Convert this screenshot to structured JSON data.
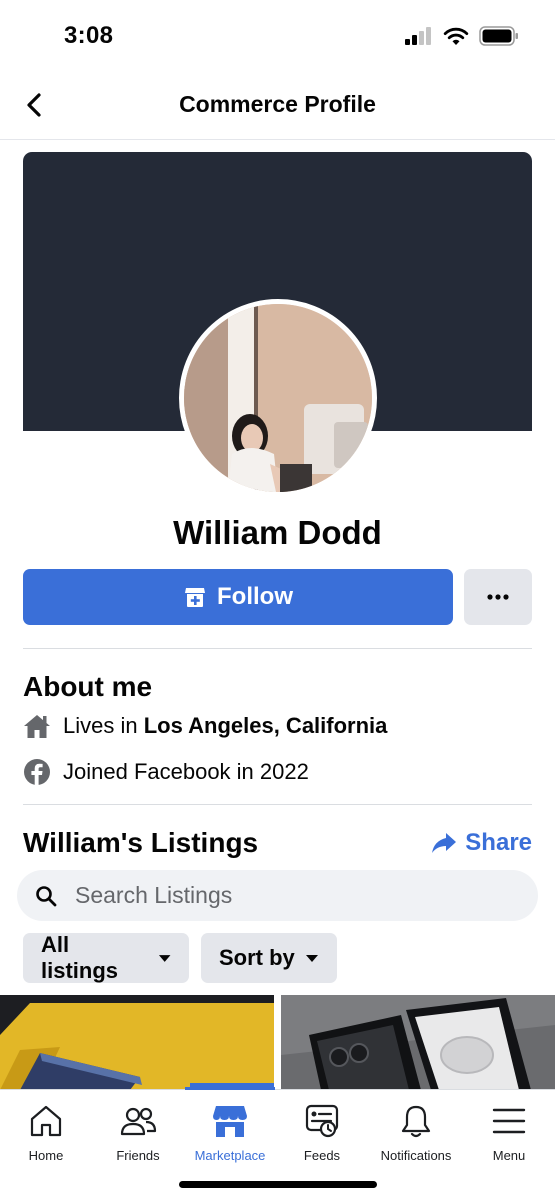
{
  "status_bar": {
    "time": "3:08"
  },
  "nav": {
    "title": "Commerce Profile"
  },
  "profile": {
    "name": "William Dodd"
  },
  "actions": {
    "follow_label": "Follow"
  },
  "about": {
    "title": "About me",
    "lives_prefix": "Lives in ",
    "location": "Los Angeles, California",
    "joined": "Joined Facebook in 2022"
  },
  "listings": {
    "title": "William's Listings",
    "share_label": "Share",
    "search_placeholder": "Search Listings",
    "filter_all": "All listings",
    "filter_sort": "Sort by"
  },
  "tabs": [
    {
      "label": "Home",
      "icon": "home-icon"
    },
    {
      "label": "Friends",
      "icon": "friends-icon"
    },
    {
      "label": "Marketplace",
      "icon": "marketplace-icon",
      "active": true
    },
    {
      "label": "Feeds",
      "icon": "feeds-icon"
    },
    {
      "label": "Notifications",
      "icon": "bell-icon"
    },
    {
      "label": "Menu",
      "icon": "menu-icon"
    }
  ],
  "colors": {
    "accent": "#3a6fd8",
    "cover": "#242a37",
    "chip": "#e4e6eb",
    "search_bg": "#f0f2f5"
  }
}
